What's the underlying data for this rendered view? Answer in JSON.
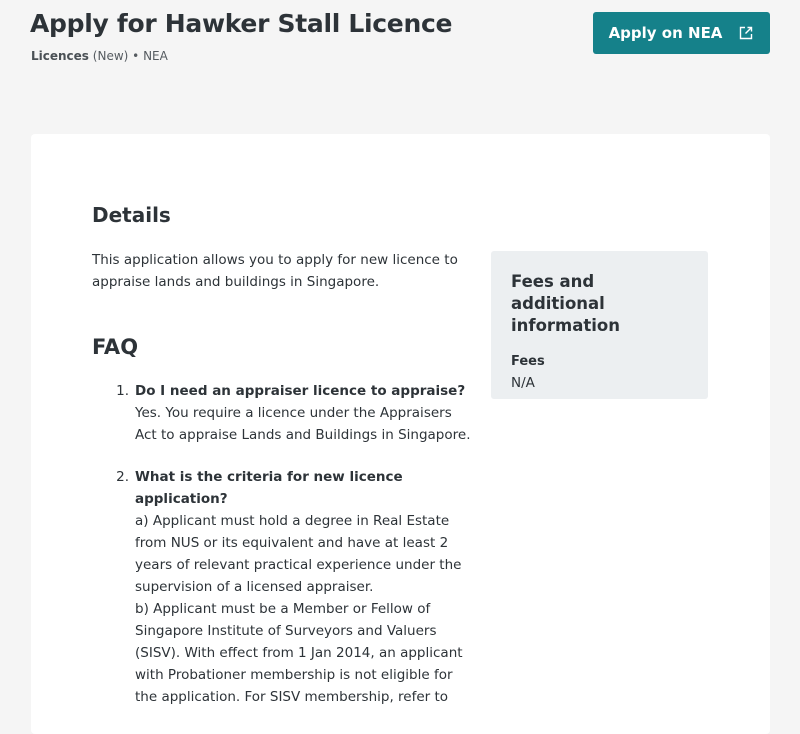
{
  "header": {
    "title": "Apply for Hawker Stall Licence",
    "category": "Licences",
    "type": "(New)",
    "separator": "•",
    "agency": "NEA",
    "apply_button_label": "Apply on NEA",
    "apply_button_icon": "external-link-icon"
  },
  "details": {
    "heading": "Details",
    "text": "This application allows you to apply for new licence to appraise lands and buildings in Singapore."
  },
  "faq": {
    "heading": "FAQ",
    "items": [
      {
        "number": "1.",
        "question": "Do I need an appraiser licence to appraise?",
        "answer": "Yes. You require a licence under the Appraisers Act to appraise Lands and Buildings in Singapore."
      },
      {
        "number": "2.",
        "question": "What is the criteria for new licence application?",
        "answer_a": "a) Applicant must hold a degree in Real Estate from NUS or its equivalent and have at least 2 years of relevant practical experience under the supervision of a licensed appraiser.",
        "answer_b": "b) Applicant must be a Member or Fellow of Singapore Institute of Surveyors and Valuers (SISV). With effect from 1 Jan 2014, an applicant with Probationer membership is not eligible for the application. For SISV membership, refer to"
      }
    ]
  },
  "fees_panel": {
    "title": "Fees and additional information",
    "fees_label": "Fees",
    "fees_value": "N/A"
  },
  "colors": {
    "accent": "#15818a",
    "page_background": "#f5f5f5",
    "card_background": "#ffffff",
    "panel_background": "#eceff1",
    "text": "#2d3338"
  }
}
